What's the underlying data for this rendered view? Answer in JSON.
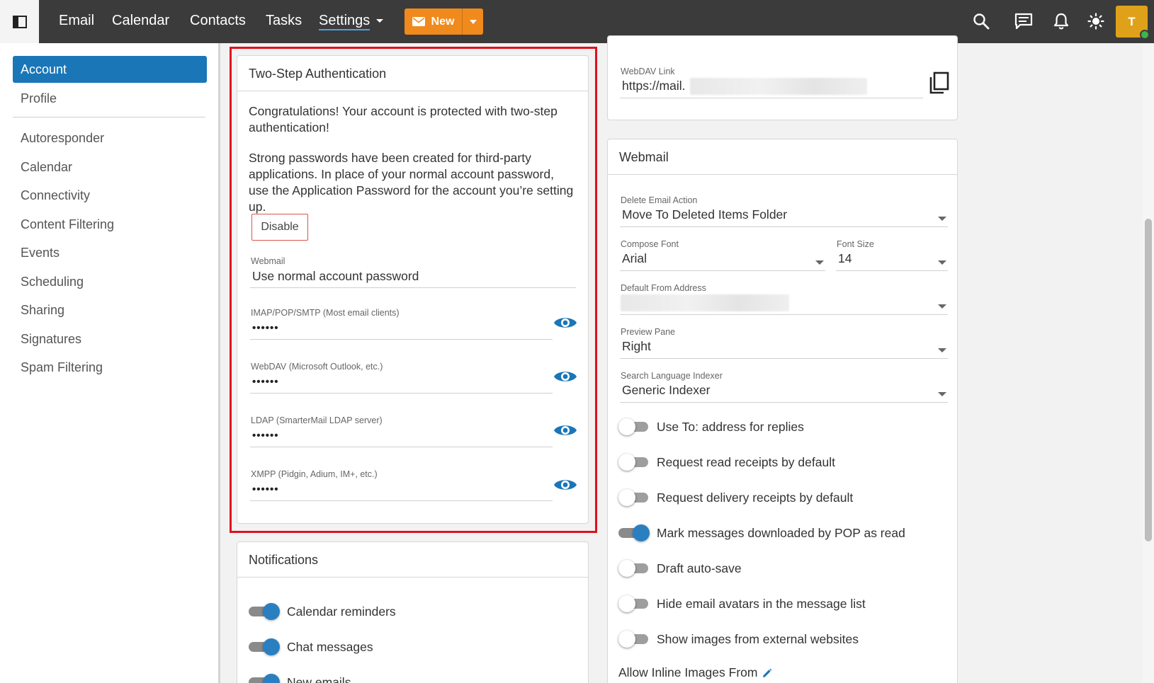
{
  "topnav": {
    "items": [
      "Email",
      "Calendar",
      "Contacts",
      "Tasks",
      "Settings"
    ],
    "new_label": "New",
    "avatar_initial": "T"
  },
  "sidenav": {
    "active": "Account",
    "items": [
      "Account",
      "Profile",
      "Autoresponder",
      "Calendar",
      "Connectivity",
      "Content Filtering",
      "Events",
      "Scheduling",
      "Sharing",
      "Signatures",
      "Spam Filtering"
    ]
  },
  "two_step": {
    "title": "Two-Step Authentication",
    "congrats": "Congratulations! Your account is protected with two-step authentication!",
    "info": "Strong passwords have been created for third-party applications. In place of your normal account password, use the Application Password for the account you’re setting up.",
    "disable_label": "Disable",
    "webmail_label": "Webmail",
    "webmail_value": "Use normal account password",
    "passwords": [
      {
        "label": "IMAP/POP/SMTP (Most email clients)",
        "value": "••••••"
      },
      {
        "label": "WebDAV (Microsoft Outlook, etc.)",
        "value": "••••••"
      },
      {
        "label": "LDAP (SmarterMail LDAP server)",
        "value": "••••••"
      },
      {
        "label": "XMPP (Pidgin, Adium, IM+, etc.)",
        "value": "••••••"
      }
    ]
  },
  "notifications": {
    "title": "Notifications",
    "toggles": [
      {
        "label": "Calendar reminders",
        "on": true
      },
      {
        "label": "Chat messages",
        "on": true
      },
      {
        "label": "New emails",
        "on": true
      }
    ]
  },
  "webdav": {
    "label": "WebDAV Link",
    "value": "https://mail."
  },
  "webmail": {
    "title": "Webmail",
    "delete_action_label": "Delete Email Action",
    "delete_action_value": "Move To Deleted Items Folder",
    "compose_font_label": "Compose Font",
    "compose_font_value": "Arial",
    "font_size_label": "Font Size",
    "font_size_value": "14",
    "default_from_label": "Default From Address",
    "preview_pane_label": "Preview Pane",
    "preview_pane_value": "Right",
    "search_indexer_label": "Search Language Indexer",
    "search_indexer_value": "Generic Indexer",
    "toggles": [
      {
        "label": "Use To: address for replies",
        "on": false
      },
      {
        "label": "Request read receipts by default",
        "on": false
      },
      {
        "label": "Request delivery receipts by default",
        "on": false
      },
      {
        "label": "Mark messages downloaded by POP as read",
        "on": true
      },
      {
        "label": "Draft auto-save",
        "on": false
      },
      {
        "label": "Hide email avatars in the message list",
        "on": false
      },
      {
        "label": "Show images from external websites",
        "on": false
      }
    ],
    "inline_images_label": "Allow Inline Images From"
  },
  "colors": {
    "accent": "#1a76b7",
    "new_button": "#f08a1c",
    "highlight_border": "#e0101e",
    "topbar": "#3b3b3b"
  }
}
